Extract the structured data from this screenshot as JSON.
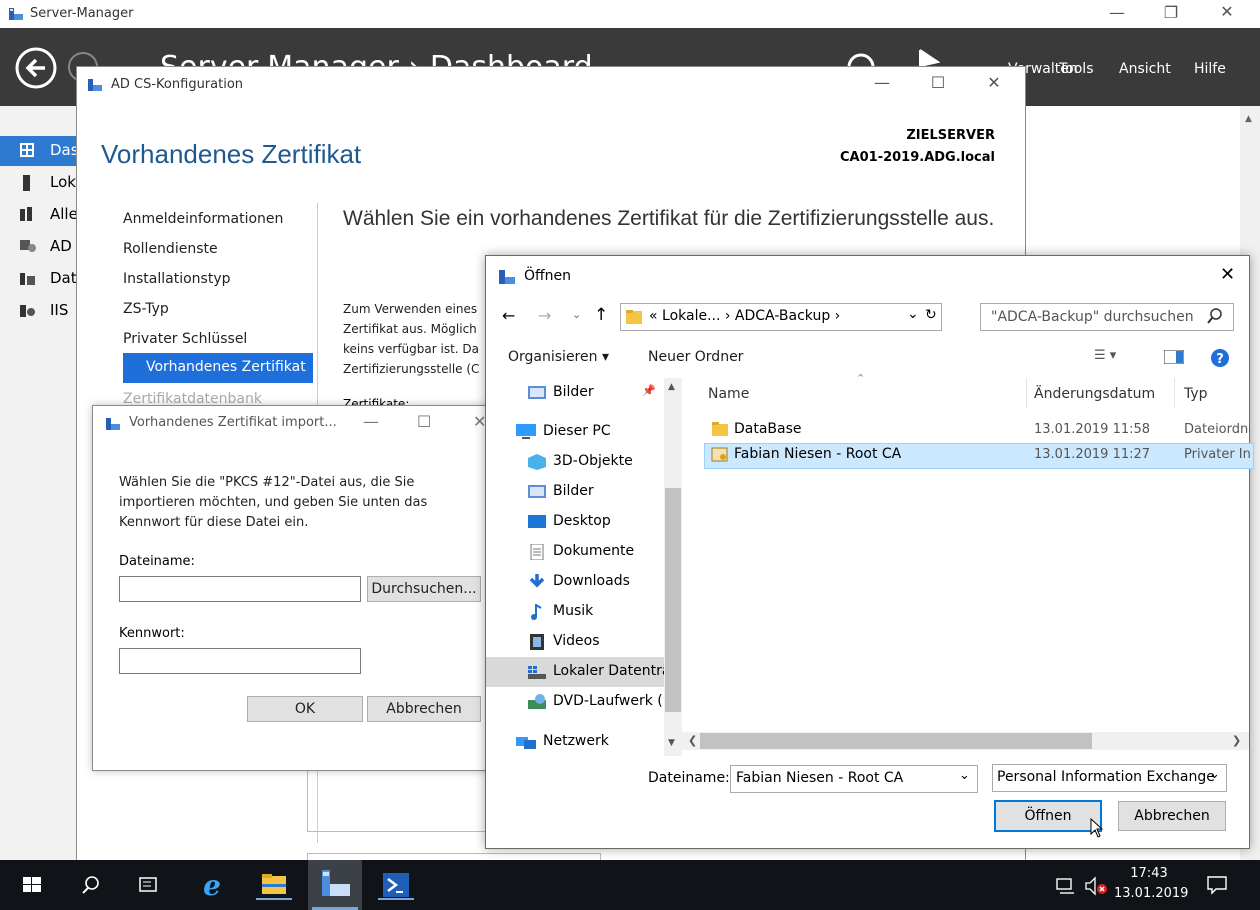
{
  "server_manager": {
    "window_title": "Server-Manager",
    "breadcrumb": "Server-Manager › Dashboard",
    "menu": [
      "Verwalten",
      "Tools",
      "Ansicht",
      "Hilfe"
    ],
    "sidebar": [
      {
        "label": "Dashboard",
        "icon": "dashboard-icon",
        "selected": true
      },
      {
        "label": "Lokaler Server",
        "icon": "server-icon"
      },
      {
        "label": "Alle Server",
        "icon": "servers-icon"
      },
      {
        "label": "AD CS",
        "icon": "adcs-icon"
      },
      {
        "label": "Datei-/Speicherdienste",
        "icon": "storage-icon"
      },
      {
        "label": "IIS",
        "icon": "iis-icon"
      }
    ]
  },
  "adcs": {
    "window_title": "AD CS-Konfiguration",
    "heading": "Vorhandenes Zertifikat",
    "target_label": "ZIELSERVER",
    "target_server": "CA01-2019.ADG.local",
    "nav": [
      "Anmeldeinformationen",
      "Rollendienste",
      "Installationstyp",
      "ZS-Typ",
      "Privater Schlüssel",
      "Vorhandenes Zertifikat",
      "Zertifikatdatenbank"
    ],
    "nav_selected": "Vorhandenes Zertifikat",
    "main_heading": "Wählen Sie ein vorhandenes Zertifikat für die Zertifizierungsstelle aus.",
    "para_lines": [
      "Zum Verwenden eines",
      "Zertifikat aus. Möglich",
      "keins verfügbar ist. Da",
      "Zertifizierungsstelle (C"
    ],
    "cert_label": "Zertifikate:"
  },
  "import_dialog": {
    "title": "Vorhandenes Zertifikat import...",
    "description": "Wählen Sie die \"PKCS #12\"-Datei aus, die Sie importieren möchten, und geben Sie unten das Kennwort für diese Datei ein.",
    "filename_label": "Dateiname:",
    "filename_value": "",
    "browse_button": "Durchsuchen...",
    "password_label": "Kennwort:",
    "password_value": "",
    "ok_button": "OK",
    "cancel_button": "Abbrechen"
  },
  "open_dialog": {
    "title": "Öffnen",
    "address": "« Lokale... › ADCA-Backup ›",
    "search_placeholder": "\"ADCA-Backup\" durchsuchen",
    "organize": "Organisieren ▾",
    "new_folder": "Neuer Ordner",
    "tree": [
      {
        "label": "Bilder",
        "icon": "pictures-icon",
        "indent": 1,
        "pinned": true
      },
      {
        "label": "Dieser PC",
        "icon": "pc-icon",
        "indent": 0
      },
      {
        "label": "3D-Objekte",
        "icon": "3d-objects-icon",
        "indent": 1
      },
      {
        "label": "Bilder",
        "icon": "pictures-icon",
        "indent": 1
      },
      {
        "label": "Desktop",
        "icon": "desktop-icon",
        "indent": 1
      },
      {
        "label": "Dokumente",
        "icon": "documents-icon",
        "indent": 1
      },
      {
        "label": "Downloads",
        "icon": "downloads-icon",
        "indent": 1
      },
      {
        "label": "Musik",
        "icon": "music-icon",
        "indent": 1
      },
      {
        "label": "Videos",
        "icon": "videos-icon",
        "indent": 1
      },
      {
        "label": "Lokaler Datenträ",
        "icon": "drive-icon",
        "indent": 1,
        "selected": true
      },
      {
        "label": "DVD-Laufwerk (D",
        "icon": "dvd-icon",
        "indent": 1
      },
      {
        "label": "Netzwerk",
        "icon": "network-icon",
        "indent": 0
      }
    ],
    "columns": [
      "Name",
      "Änderungsdatum",
      "Typ"
    ],
    "files": [
      {
        "name": "DataBase",
        "date": "13.01.2019 11:58",
        "type": "Dateiordner",
        "icon": "folder-icon"
      },
      {
        "name": "Fabian Niesen - Root CA",
        "date": "13.01.2019 11:27",
        "type": "Privater Informationsaustausch",
        "icon": "certificate-icon",
        "selected": true
      }
    ],
    "filename_label": "Dateiname:",
    "filename_value": "Fabian Niesen - Root CA",
    "filetype_value": "Personal Information Exchange",
    "open_button": "Öffnen",
    "cancel_button": "Abbrechen"
  },
  "taskbar": {
    "time": "17:43",
    "date": "13.01.2019"
  }
}
